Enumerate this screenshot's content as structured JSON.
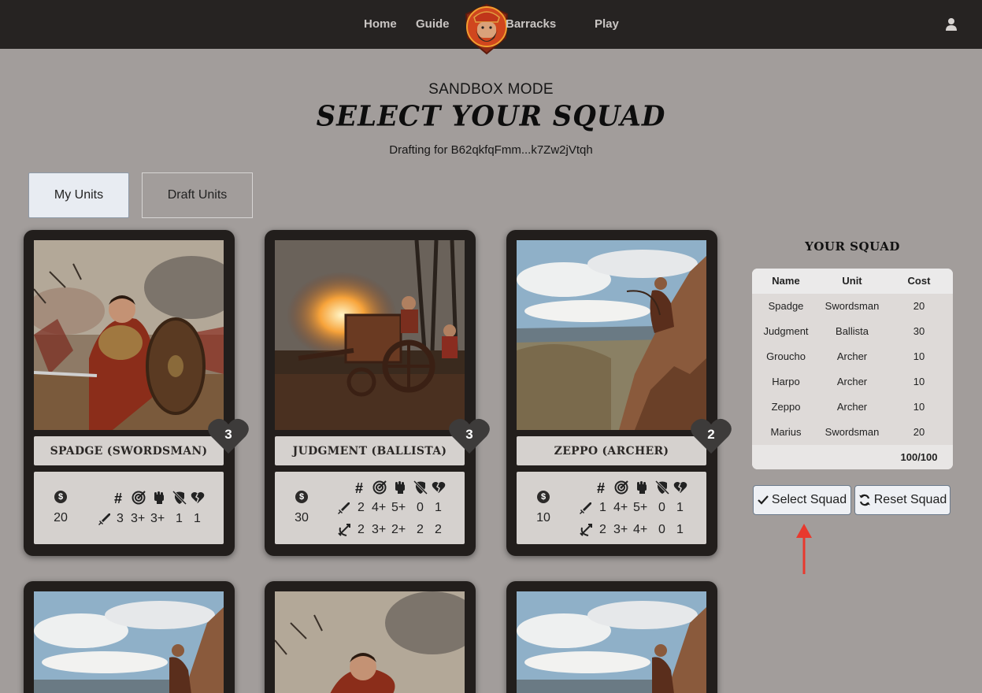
{
  "nav": {
    "links": [
      "Home",
      "Guide",
      "Barracks",
      "Play"
    ]
  },
  "header": {
    "mode": "SANDBOX MODE",
    "title": "SELECT YOUR SQUAD",
    "drafting": "Drafting for B62qkfqFmm...k7Zw2jVtqh"
  },
  "tabs": [
    "My Units",
    "Draft Units"
  ],
  "cards": [
    {
      "name": "SPADGE (SWORDSMAN)",
      "hearts": "3",
      "cost": "20",
      "rows": [
        {
          "type": "melee",
          "vals": [
            "3",
            "3+",
            "3+",
            "1",
            "1"
          ]
        }
      ]
    },
    {
      "name": "JUDGMENT (BALLISTA)",
      "hearts": "3",
      "cost": "30",
      "rows": [
        {
          "type": "melee",
          "vals": [
            "2",
            "4+",
            "5+",
            "0",
            "1"
          ]
        },
        {
          "type": "ranged",
          "vals": [
            "2",
            "3+",
            "2+",
            "2",
            "2"
          ]
        }
      ]
    },
    {
      "name": "ZEPPO (ARCHER)",
      "hearts": "2",
      "cost": "10",
      "rows": [
        {
          "type": "melee",
          "vals": [
            "1",
            "4+",
            "5+",
            "0",
            "1"
          ]
        },
        {
          "type": "ranged",
          "vals": [
            "2",
            "3+",
            "4+",
            "0",
            "1"
          ]
        }
      ]
    }
  ],
  "stat_headers": [
    "#",
    "accuracy-icon",
    "strength-icon",
    "armor-pierce-icon",
    "damage-icon"
  ],
  "squad": {
    "title": "YOUR SQUAD",
    "columns": [
      "Name",
      "Unit",
      "Cost"
    ],
    "rows": [
      [
        "Spadge",
        "Swordsman",
        "20"
      ],
      [
        "Judgment",
        "Ballista",
        "30"
      ],
      [
        "Groucho",
        "Archer",
        "10"
      ],
      [
        "Harpo",
        "Archer",
        "10"
      ],
      [
        "Zeppo",
        "Archer",
        "10"
      ],
      [
        "Marius",
        "Swordsman",
        "20"
      ]
    ],
    "total": "100/100",
    "select_label": "Select Squad",
    "reset_label": "Reset Squad"
  },
  "colors": {
    "nav_bg": "#262322",
    "page_bg": "#a29d9b",
    "card_bg": "#221e1c",
    "annotation_arrow": "#e8392e"
  }
}
